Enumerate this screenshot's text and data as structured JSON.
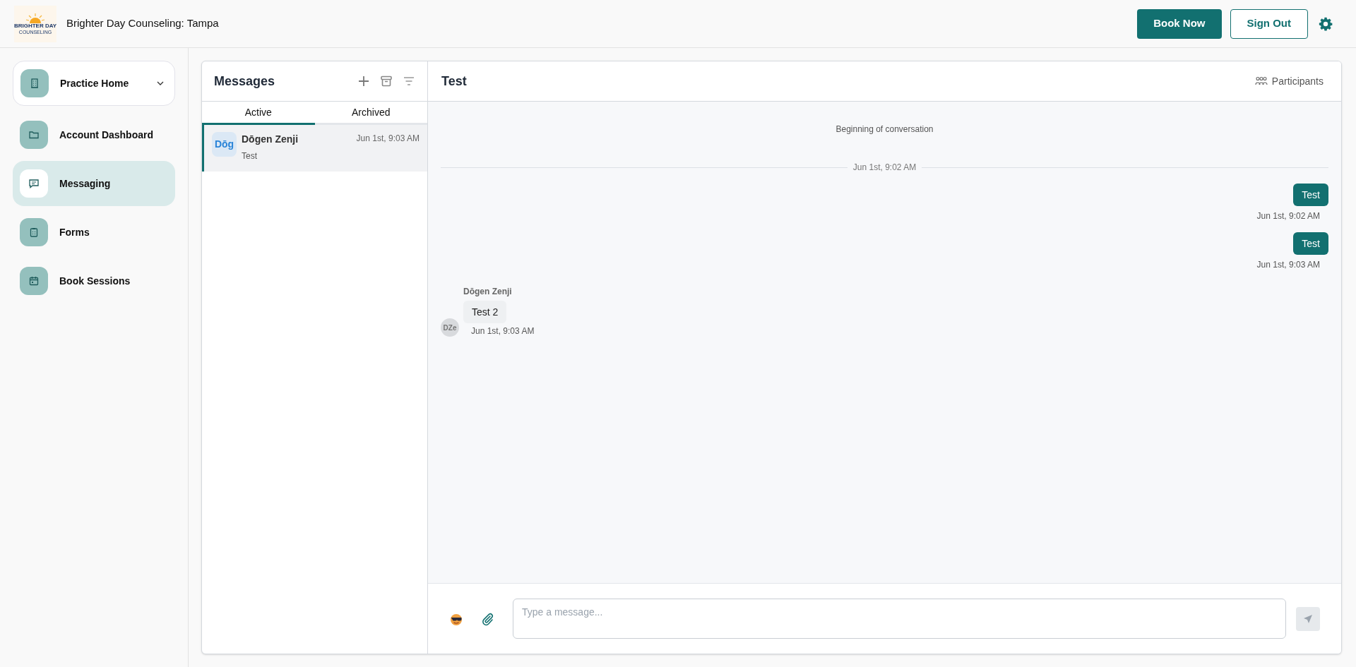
{
  "header": {
    "logo": {
      "line_1": "BRIGHTER DAY",
      "line_2": "COUNSELING"
    },
    "title": "Brighter Day Counseling: Tampa",
    "buttons": [
      {
        "label": "Book Now",
        "kind": "primary"
      },
      {
        "label": "Sign Out",
        "kind": "outline"
      }
    ]
  },
  "sidebar": {
    "items": [
      {
        "label": "Practice Home",
        "kind": "dropdown",
        "selected": false
      },
      {
        "label": "Account Dashboard",
        "kind": "link",
        "selected": false
      },
      {
        "label": "Messaging",
        "kind": "link",
        "selected": true
      },
      {
        "label": "Forms",
        "kind": "link",
        "selected": false
      },
      {
        "label": "Book Sessions",
        "kind": "link",
        "selected": false
      }
    ]
  },
  "messages_panel": {
    "title": "Messages",
    "tabs": [
      {
        "label": "Active",
        "selected": true
      },
      {
        "label": "Archived",
        "selected": false
      }
    ],
    "conversations": [
      {
        "avatar": "Dōg",
        "name": "Dōgen Zenji",
        "preview": "Test",
        "time": "Jun 1st, 9:03 AM",
        "selected": true
      }
    ]
  },
  "chat": {
    "title": "Test",
    "participants_label": "Participants",
    "timeline": [
      {
        "kind": "notice",
        "text": "Beginning of conversation"
      },
      {
        "kind": "divider",
        "text": "Jun 1st, 9:02 AM"
      },
      {
        "kind": "outgoing",
        "text": "Test",
        "time": "Jun 1st, 9:02 AM"
      },
      {
        "kind": "outgoing",
        "text": "Test",
        "time": "Jun 1st, 9:03 AM"
      },
      {
        "kind": "incoming",
        "sender": "Dōgen Zenji",
        "avatar": "DZe",
        "text": "Test 2",
        "time": "Jun 1st, 9:03 AM"
      }
    ],
    "composer": {
      "placeholder": "Type a message..."
    }
  }
}
